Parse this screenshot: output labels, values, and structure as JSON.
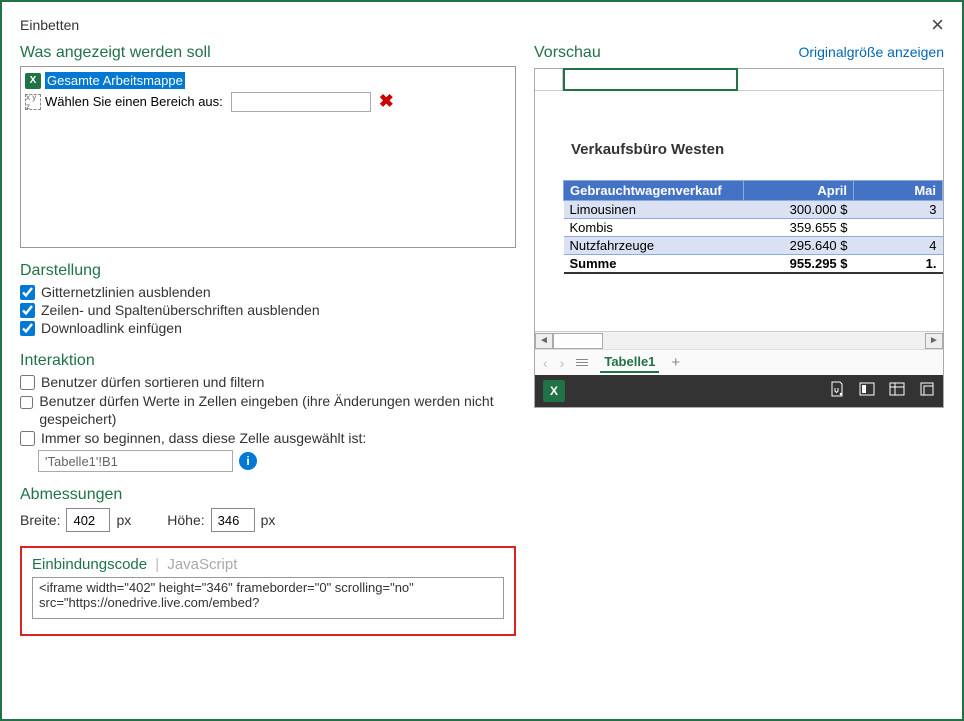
{
  "dialog": {
    "title": "Einbetten",
    "close_glyph": "×"
  },
  "what_to_show": {
    "heading": "Was angezeigt werden soll",
    "workbook_label": "Gesamte Arbeitsmappe",
    "range_label": "Wählen Sie einen Bereich aus:",
    "range_value": "",
    "delete_glyph": "✖"
  },
  "appearance": {
    "heading": "Darstellung",
    "hide_gridlines": "Gitternetzlinien ausblenden",
    "hide_headers": "Zeilen- und Spaltenüberschriften ausblenden",
    "download_link": "Downloadlink einfügen"
  },
  "interaction": {
    "heading": "Interaktion",
    "allow_sort": "Benutzer dürfen sortieren und filtern",
    "allow_type": "Benutzer dürfen Werte in Zellen eingeben (ihre Änderungen werden nicht gespeichert)",
    "always_cell": "Immer so beginnen, dass diese Zelle ausgewählt ist:",
    "cell_ref": "'Tabelle1'!B1"
  },
  "dimensions": {
    "heading": "Abmessungen",
    "width_label": "Breite:",
    "width_value": "402",
    "width_unit": "px",
    "height_label": "Höhe:",
    "height_value": "346",
    "height_unit": "px"
  },
  "embed": {
    "tab_code": "Einbindungscode",
    "tab_js": "JavaScript",
    "code": "<iframe width=\"402\" height=\"346\" frameborder=\"0\" scrolling=\"no\" src=\"https://onedrive.live.com/embed?"
  },
  "preview": {
    "heading": "Vorschau",
    "original_link": "Originalgröße anzeigen",
    "sheet_title": "Verkaufsbüro Westen",
    "headers": {
      "col1": "Gebrauchtwagenverkauf",
      "col2": "April",
      "col3": "Mai"
    },
    "rows": [
      {
        "label": "Limousinen",
        "april": "300.000 $",
        "mai": "3"
      },
      {
        "label": "Kombis",
        "april": "359.655 $",
        "mai": ""
      },
      {
        "label": "Nutzfahrzeuge",
        "april": "295.640 $",
        "mai": "4"
      },
      {
        "label": "Summe",
        "april": "955.295 $",
        "mai": "1.",
        "total": true
      }
    ],
    "tab_name": "Tabelle1",
    "plus_glyph": "+"
  },
  "icons": {
    "xl": "X",
    "xyz": "x y z",
    "info": "i",
    "chev_left": "‹",
    "chev_right": "›",
    "tri_left": "◄",
    "tri_right": "►"
  }
}
